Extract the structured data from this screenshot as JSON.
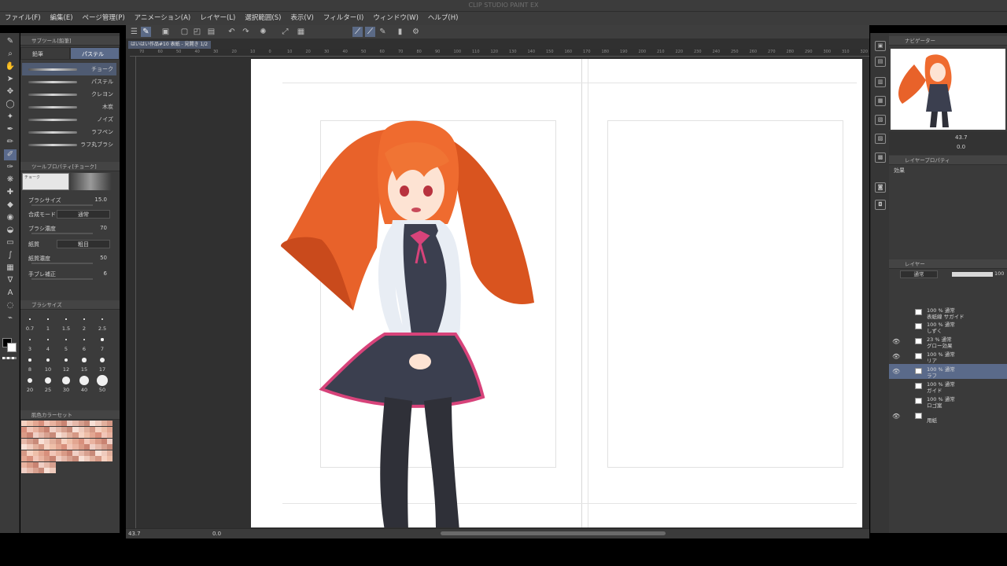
{
  "window": {
    "title": "CLIP STUDIO PAINT EX"
  },
  "menu": [
    "ファイル(F)",
    "編集(E)",
    "ページ管理(P)",
    "アニメーション(A)",
    "レイヤー(L)",
    "選択範囲(S)",
    "表示(V)",
    "フィルター(I)",
    "ウィンドウ(W)",
    "ヘルプ(H)"
  ],
  "subtool": {
    "header": "サブツール[鉛筆]",
    "tabs": [
      "鉛筆",
      "パステル"
    ],
    "brushes": [
      "チョーク",
      "パステル",
      "クレヨン",
      "木炭",
      "ノイズ",
      "ラフペン",
      "ラフ丸ブラシ"
    ]
  },
  "tool_property": {
    "header": "ツールプロパティ[チョーク]",
    "brush_name": "チョーク",
    "rows": [
      {
        "label": "ブラシサイズ",
        "value": "15.0"
      },
      {
        "label": "合成モード",
        "value": "通常"
      },
      {
        "label": "ブラシ濃度",
        "value": "70"
      },
      {
        "label": "紙質",
        "value": "粗目"
      },
      {
        "label": "紙質濃度",
        "value": "50"
      },
      {
        "label": "手ブレ補正",
        "value": "6"
      }
    ]
  },
  "brush_size": {
    "header": "ブラシサイズ",
    "sizes": [
      "0.7",
      "1",
      "1.5",
      "2",
      "2.5",
      "3",
      "4",
      "5",
      "6",
      "7",
      "8",
      "10",
      "12",
      "15",
      "17",
      "20",
      "25",
      "30",
      "40",
      "50"
    ]
  },
  "color_set": {
    "header": "肌色カラーセット"
  },
  "document": {
    "tab": "はいはい作品#10 表紙 - 見開き 1/2"
  },
  "ruler_ticks": [
    "70",
    "60",
    "50",
    "40",
    "30",
    "20",
    "10",
    "0",
    "10",
    "20",
    "30",
    "40",
    "50",
    "60",
    "70",
    "80",
    "90",
    "100",
    "110",
    "120",
    "130",
    "140",
    "150",
    "160",
    "170",
    "180",
    "190",
    "200",
    "210",
    "220",
    "230",
    "240",
    "250",
    "260",
    "270",
    "280",
    "290",
    "300",
    "310",
    "320"
  ],
  "status": {
    "zoom": "43.7",
    "rotation": "0.0"
  },
  "navigator": {
    "header": "ナビゲーター",
    "zoom": "43.7",
    "angle": "0.0"
  },
  "layer_property": {
    "header": "レイヤープロパティ",
    "effect_label": "効果"
  },
  "layer_panel": {
    "header": "レイヤー",
    "blend_mode": "通常",
    "opacity": "100",
    "layers": [
      {
        "line1": "100 % 通常",
        "line2": "表紙線 サガイド"
      },
      {
        "line1": "100 % 通常",
        "line2": "しずく"
      },
      {
        "line1": "23 % 通常",
        "line2": "グロー効果"
      },
      {
        "line1": "100 % 通常",
        "line2": "リア"
      },
      {
        "line1": "100 % 通常",
        "line2": "ラフ"
      },
      {
        "line1": "100 % 通常",
        "line2": "ガイド"
      },
      {
        "line1": "100 % 通常",
        "line2": "ロゴ案"
      },
      {
        "line1": "",
        "line2": "用紙"
      }
    ]
  },
  "colors": {
    "accent": "#5b6b8a",
    "panel": "#3b3b3b",
    "canvas_bg": "#303030",
    "hair": "#e8622a",
    "skirt": "#3b3f4f",
    "ribbon": "#d7437a"
  }
}
